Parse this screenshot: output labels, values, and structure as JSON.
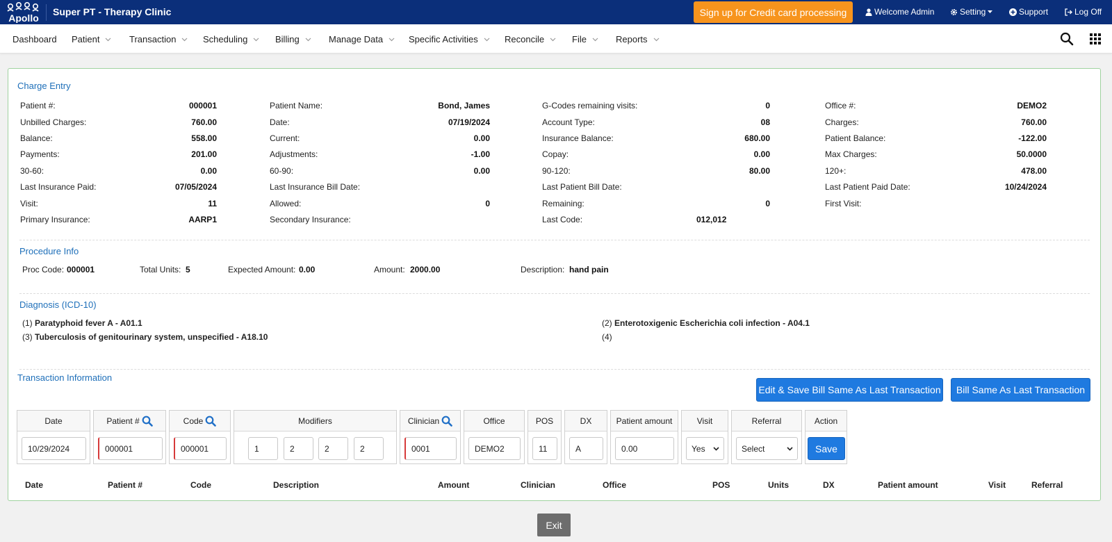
{
  "header": {
    "logo_text": "Apollo",
    "app_title": "Super PT - Therapy Clinic",
    "signup_label": "Sign up for Credit card processing",
    "welcome_label": "Welcome Admin",
    "setting_label": "Setting",
    "support_label": "Support",
    "logoff_label": "Log Off",
    "signup_color": "#f7941d",
    "bar_color": "#0b2f7a"
  },
  "menu": {
    "items": [
      "Dashboard",
      "Patient",
      "Transaction",
      "Scheduling",
      "Billing",
      "Manage Data",
      "Specific Activities",
      "Reconcile",
      "File",
      "Reports"
    ],
    "search_icon": "search-icon",
    "apps_icon": "grid-icon"
  },
  "charge_entry": {
    "title": "Charge Entry",
    "col1": [
      {
        "label": "Patient #:",
        "value": "000001"
      },
      {
        "label": "Unbilled Charges:",
        "value": "760.00"
      },
      {
        "label": "Balance:",
        "value": "558.00"
      },
      {
        "label": "Payments:",
        "value": "201.00"
      },
      {
        "label": "30-60:",
        "value": "0.00"
      },
      {
        "label": "Last Insurance Paid:",
        "value": "07/05/2024"
      },
      {
        "label": "Visit:",
        "value": "11"
      },
      {
        "label": "Primary Insurance:",
        "value": "AARP1"
      }
    ],
    "col2": [
      {
        "label": "Patient Name:",
        "value": "Bond, James"
      },
      {
        "label": "Date:",
        "value": "07/19/2024"
      },
      {
        "label": "Current:",
        "value": "0.00"
      },
      {
        "label": "Adjustments:",
        "value": "-1.00"
      },
      {
        "label": "60-90:",
        "value": "0.00"
      },
      {
        "label": "Last Insurance Bill Date:",
        "value": ""
      },
      {
        "label": "Allowed:",
        "value": "0"
      },
      {
        "label": "Secondary Insurance:",
        "value": ""
      }
    ],
    "col3": [
      {
        "label": "G-Codes remaining visits:",
        "value": "0"
      },
      {
        "label": "Account Type:",
        "value": "08"
      },
      {
        "label": "Insurance Balance:",
        "value": "680.00"
      },
      {
        "label": "Copay:",
        "value": "0.00"
      },
      {
        "label": "90-120:",
        "value": "80.00"
      },
      {
        "label": "Last Patient Bill Date:",
        "value": ""
      },
      {
        "label": "Remaining:",
        "value": "0"
      },
      {
        "label": "Last Code:",
        "value": "012,012"
      }
    ],
    "col4": [
      {
        "label": "Office #:",
        "value": "DEMO2"
      },
      {
        "label": "Charges:",
        "value": "760.00"
      },
      {
        "label": "Patient Balance:",
        "value": "-122.00"
      },
      {
        "label": "Max Charges:",
        "value": "50.0000"
      },
      {
        "label": "120+:",
        "value": "478.00"
      },
      {
        "label": "Last Patient Paid Date:",
        "value": "10/24/2024"
      },
      {
        "label": "First Visit:",
        "value": ""
      },
      {
        "label": "",
        "value": ""
      }
    ]
  },
  "procedure": {
    "title": "Procedure Info",
    "proc_code_label": "Proc Code:",
    "proc_code": "000001",
    "units_label": "Total Units:",
    "units": "5",
    "expected_label": "Expected Amount:",
    "expected": "0.00",
    "amount_label": "Amount:",
    "amount": "2000.00",
    "description_label": "Description:",
    "description": "hand pain"
  },
  "diagnosis": {
    "title": "Diagnosis (ICD-10)",
    "items": [
      {
        "num": "(1)",
        "text": "Paratyphoid fever A - A01.1"
      },
      {
        "num": "(2)",
        "text": "Enterotoxigenic Escherichia coli infection - A04.1"
      },
      {
        "num": "(3)",
        "text": "Tuberculosis of genitourinary system, unspecified - A18.10"
      },
      {
        "num": "(4)",
        "text": ""
      }
    ]
  },
  "transaction": {
    "title": "Transaction Information",
    "edit_save_label": "Edit & Save Bill Same As Last Transaction",
    "bill_same_label": "Bill Same As Last Transaction",
    "headers": {
      "date": "Date",
      "patient": "Patient #",
      "code": "Code",
      "modifiers": "Modifiers",
      "clinician": "Clinician",
      "office": "Office",
      "pos": "POS",
      "dx": "DX",
      "patient_amount": "Patient amount",
      "visit": "Visit",
      "referral": "Referral",
      "action": "Action"
    },
    "values": {
      "date": "10/29/2024",
      "patient": "000001",
      "code": "000001",
      "mod1": "1",
      "mod2": "2",
      "mod3": "2",
      "mod4": "2",
      "clinician": "0001",
      "office": "DEMO2",
      "pos": "11",
      "dx": "A",
      "patient_amount": "0.00",
      "visit": "Yes",
      "referral": "Select"
    },
    "save_label": "Save",
    "table_headers": [
      "Date",
      "Patient #",
      "Code",
      "Description",
      "Amount",
      "Clinician",
      "Office",
      "POS",
      "Units",
      "DX",
      "Patient amount",
      "Visit",
      "Referral"
    ]
  },
  "footer": {
    "exit_label": "Exit"
  }
}
